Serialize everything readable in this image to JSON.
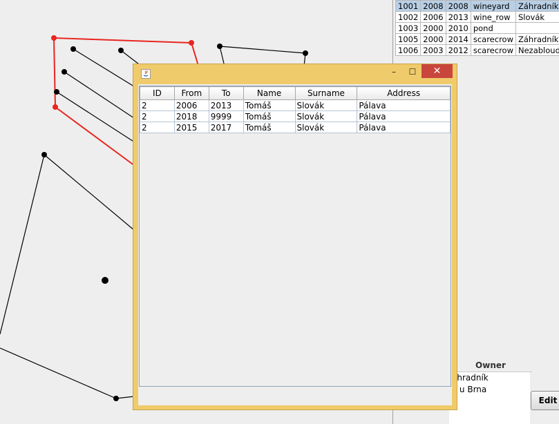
{
  "background_table": {
    "rows": [
      [
        "1001",
        "2008",
        "2008",
        "wineyard",
        "Záhradník"
      ],
      [
        "1002",
        "2006",
        "2013",
        "wine_row",
        "Slovák"
      ],
      [
        "1003",
        "2000",
        "2010",
        "pond",
        ""
      ],
      [
        "1005",
        "2000",
        "2014",
        "scarecrow",
        "Záhradník"
      ],
      [
        "1006",
        "2003",
        "2012",
        "scarecrow",
        "Nezabloudil"
      ]
    ]
  },
  "owner_panel": {
    "header": "Owner",
    "items": [
      "áhradník",
      "v u Brna"
    ]
  },
  "edit_button": "Edit",
  "dialog": {
    "title": "",
    "columns": [
      "ID",
      "From",
      "To",
      "Name",
      "Surname",
      "Address"
    ],
    "rows": [
      [
        "2",
        "2006",
        "2013",
        "Tomáš",
        "Slovák",
        "Pálava"
      ],
      [
        "2",
        "2018",
        "9999",
        "Tomáš",
        "Slovák",
        "Pálava"
      ],
      [
        "2",
        "2015",
        "2017",
        "Tomáš",
        "Slovák",
        "Pálava"
      ]
    ],
    "minimize": "–",
    "maximize": "☐",
    "close": "✕"
  },
  "colors": {
    "dialog_frame": "#f0cb6b",
    "close_button": "#c9463d",
    "selected_polygon": "#e8251f"
  }
}
